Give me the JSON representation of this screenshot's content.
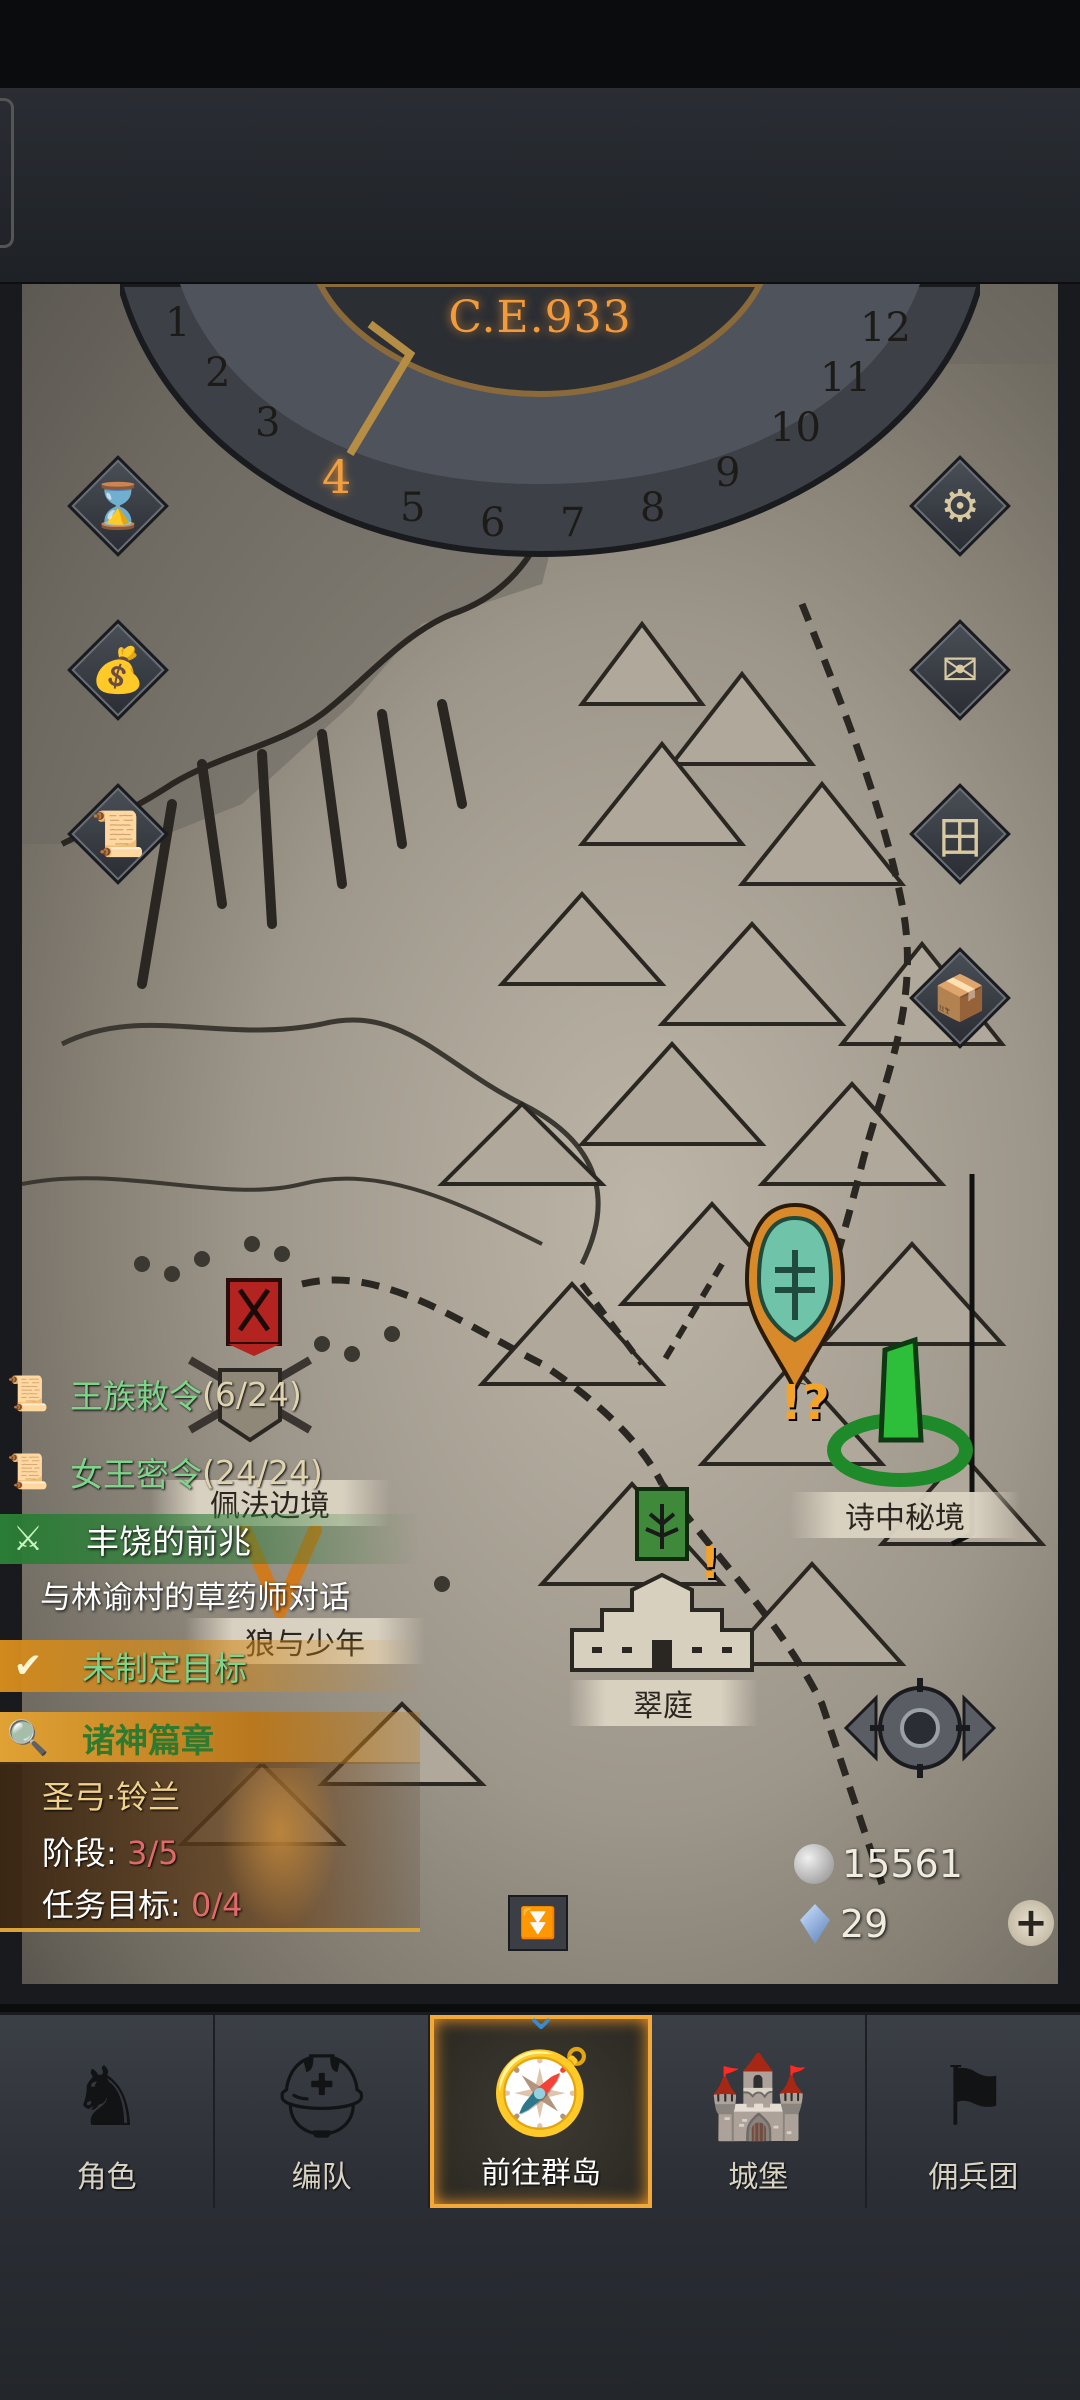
{
  "calendar": {
    "era": "C.E.933",
    "months": [
      "1",
      "2",
      "3",
      "4",
      "5",
      "6",
      "7",
      "8",
      "9",
      "10",
      "11",
      "12"
    ],
    "current_month": "4"
  },
  "left_buttons": [
    {
      "name": "hourglass-button",
      "icon": "hourglass-icon",
      "glyph": "⌛"
    },
    {
      "name": "bag-button",
      "icon": "money-bag-icon",
      "glyph": "💰"
    },
    {
      "name": "scroll-button",
      "icon": "scroll-icon",
      "glyph": "📜"
    }
  ],
  "right_buttons": [
    {
      "name": "settings-button",
      "icon": "gear-icon",
      "glyph": "⚙"
    },
    {
      "name": "mail-button",
      "icon": "envelope-icon",
      "glyph": "✉"
    },
    {
      "name": "grid-button",
      "icon": "window-grid-icon",
      "glyph": "田"
    },
    {
      "name": "inventory-button",
      "icon": "bag-and-crate-icon",
      "glyph": "📦"
    }
  ],
  "quests": {
    "royal_order": {
      "label": "王族敕令",
      "count": "(6/24)"
    },
    "queen_order": {
      "label": "女王密令",
      "count": "(24/24)"
    },
    "main_quest": {
      "title": "丰饶的前兆",
      "task": "与林谕村的草药师对话"
    },
    "unset_goal": {
      "label": "未制定目标"
    },
    "epic": {
      "title": "诸神篇章",
      "hero": "圣弓·铃兰",
      "stage_label": "阶段: ",
      "stage_value": "3/5",
      "goal_label": "任务目标: ",
      "goal_value": "0/4"
    }
  },
  "locations": {
    "peifa_border": "佩法边境",
    "wolf_and_boy": "狼与少年",
    "cuiting": "翠庭",
    "poem_secret": "诗中秘境"
  },
  "currency": {
    "silver": "15561",
    "crystal": "29"
  },
  "nav": {
    "items": [
      {
        "label": "角色",
        "name": "nav-character",
        "icon": "knight-icon",
        "glyph": "♞"
      },
      {
        "label": "编队",
        "name": "nav-formation",
        "icon": "helmet-icon",
        "glyph": "⛑"
      },
      {
        "label": "前往群岛",
        "name": "nav-archipelago",
        "icon": "compass-icon",
        "glyph": "🧭"
      },
      {
        "label": "城堡",
        "name": "nav-castle",
        "icon": "castle-icon",
        "glyph": "🏰"
      },
      {
        "label": "佣兵团",
        "name": "nav-mercenary",
        "icon": "banner-icon",
        "glyph": "⚑"
      }
    ],
    "active": "前往群岛"
  },
  "colors": {
    "accent_orange": "#f39a3a",
    "quest_green": "#7ed48a",
    "stage_red": "#e06a6a"
  }
}
